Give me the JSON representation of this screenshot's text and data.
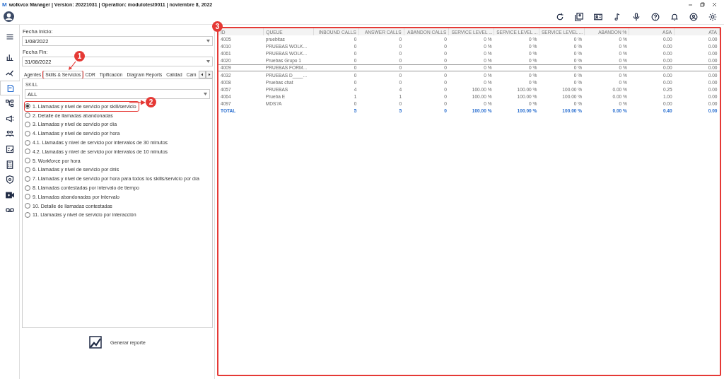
{
  "window": {
    "logo": "M",
    "title": "wolkvox Manager  | Version: 20221031 |  Operation: modulotest0011 | noviembre 8, 2022"
  },
  "sidebar": {
    "items": [
      {
        "selected": false
      },
      {
        "selected": false
      },
      {
        "selected": false
      },
      {
        "selected": true
      },
      {
        "selected": false
      },
      {
        "selected": false
      },
      {
        "selected": false
      },
      {
        "selected": false
      },
      {
        "selected": false
      },
      {
        "selected": false
      },
      {
        "selected": false
      },
      {
        "selected": false
      }
    ]
  },
  "filters": {
    "start_label": "Fecha Inicio:",
    "start_value": "1/08/2022",
    "end_label": "Fecha Fin:",
    "end_value": "31/08/2022"
  },
  "tabs": [
    {
      "label": "Agentes",
      "selected": false
    },
    {
      "label": "Skills & Servicios",
      "selected": true,
      "highlighted": true
    },
    {
      "label": "CDR",
      "selected": false
    },
    {
      "label": "Tipificación",
      "selected": false
    },
    {
      "label": "Diagram Reports",
      "selected": false
    },
    {
      "label": "Calidad",
      "selected": false
    },
    {
      "label": "Cam",
      "selected": false
    }
  ],
  "skill": {
    "label": "SKILL",
    "value": "ALL"
  },
  "reports": [
    {
      "label": "1. Llamadas y nivel de servicio por skill/servicio",
      "selected": true,
      "highlighted": true
    },
    {
      "label": "2. Detalle de llamadas abandonadas",
      "selected": false
    },
    {
      "label": "3. Llamadas y nivel de servicio por día",
      "selected": false
    },
    {
      "label": "4. Llamadas y nivel de servicio por hora",
      "selected": false
    },
    {
      "label": "4.1. Llamadas y nivel de servicio por intervalos de 30 minutos",
      "selected": false
    },
    {
      "label": "4.2. Llamadas y nivel de servicio por intervalos de 10 minutos",
      "selected": false
    },
    {
      "label": "5. Workforce por hora",
      "selected": false
    },
    {
      "label": "6. Llamadas y nivel de servicio por dnis",
      "selected": false
    },
    {
      "label": "7. Llamadas y nivel de servicio por hora para todos los skills/servicio por día",
      "selected": false
    },
    {
      "label": "8. Llamadas contestadas por intervalo de tiempo",
      "selected": false
    },
    {
      "label": "9. Llamadas abandonadas por intervalo",
      "selected": false
    },
    {
      "label": "10. Detalle de llamadas contestadas",
      "selected": false
    },
    {
      "label": "11. Llamadas y nivel de servicio por interacción",
      "selected": false
    }
  ],
  "generate_button": "Generar reporte",
  "table": {
    "highlighted": true,
    "columns": [
      "ID",
      "QUEUE",
      "INBOUND CALLS",
      "ANSWER CALLS",
      "ABANDON CALLS",
      "SERVICE LEVEL ...",
      "SERVICE LEVEL ...",
      "SERVICE LEVEL ...",
      "ABANDON %",
      "ASA",
      "ATA"
    ],
    "rows": [
      {
        "cells": [
          "4005",
          "pruebitas",
          "0",
          "0",
          "0",
          "0 %",
          "0 %",
          "0 %",
          "0 %",
          "0.00",
          "0.00"
        ],
        "selected": false
      },
      {
        "cells": [
          "4010",
          "PRUEBAS WOLK...",
          "0",
          "0",
          "0",
          "0 %",
          "0 %",
          "0 %",
          "0 %",
          "0.00",
          "0.00"
        ],
        "selected": false
      },
      {
        "cells": [
          "4061",
          "PRUEBAS WOLK...",
          "0",
          "0",
          "0",
          "0 %",
          "0 %",
          "0 %",
          "0 %",
          "0.00",
          "0.00"
        ],
        "selected": false
      },
      {
        "cells": [
          "4020",
          "Pruebas Grupo 1",
          "0",
          "0",
          "0",
          "0 %",
          "0 %",
          "0 %",
          "0 %",
          "0.00",
          "0.00"
        ],
        "selected": false
      },
      {
        "cells": [
          "4009",
          "PRUEBAS FORM...",
          "0",
          "0",
          "0",
          "0 %",
          "0 %",
          "0 %",
          "0 %",
          "0.00",
          "0.00"
        ],
        "selected": true
      },
      {
        "cells": [
          "4032",
          "PRUEBAS D____...",
          "0",
          "0",
          "0",
          "0 %",
          "0 %",
          "0 %",
          "0 %",
          "0.00",
          "0.00"
        ],
        "selected": false
      },
      {
        "cells": [
          "4008",
          "Pruebas chat",
          "0",
          "0",
          "0",
          "0 %",
          "0 %",
          "0 %",
          "0 %",
          "0.00",
          "0.00"
        ],
        "selected": false
      },
      {
        "cells": [
          "4057",
          "PRUEBAS",
          "4",
          "4",
          "0",
          "100.00 %",
          "100.00 %",
          "100.00 %",
          "0.00 %",
          "0.25",
          "0.00"
        ],
        "selected": false
      },
      {
        "cells": [
          "4064",
          "Prueba E",
          "1",
          "1",
          "0",
          "100.00 %",
          "100.00 %",
          "100.00 %",
          "0.00 %",
          "1.00",
          "0.00"
        ],
        "selected": false
      },
      {
        "cells": [
          "4097",
          "MDS?A",
          "0",
          "0",
          "0",
          "0 %",
          "0 %",
          "0 %",
          "0 %",
          "0.00",
          "0.00"
        ],
        "selected": false
      }
    ],
    "total": {
      "label": "TOTAL",
      "values": [
        "5",
        "5",
        "0",
        "100.00 %",
        "100.00 %",
        "100.00 %",
        "0.00 %",
        "0.40",
        "0.00"
      ]
    }
  },
  "annotations": [
    {
      "label": "1"
    },
    {
      "label": "2"
    },
    {
      "label": "3"
    }
  ]
}
